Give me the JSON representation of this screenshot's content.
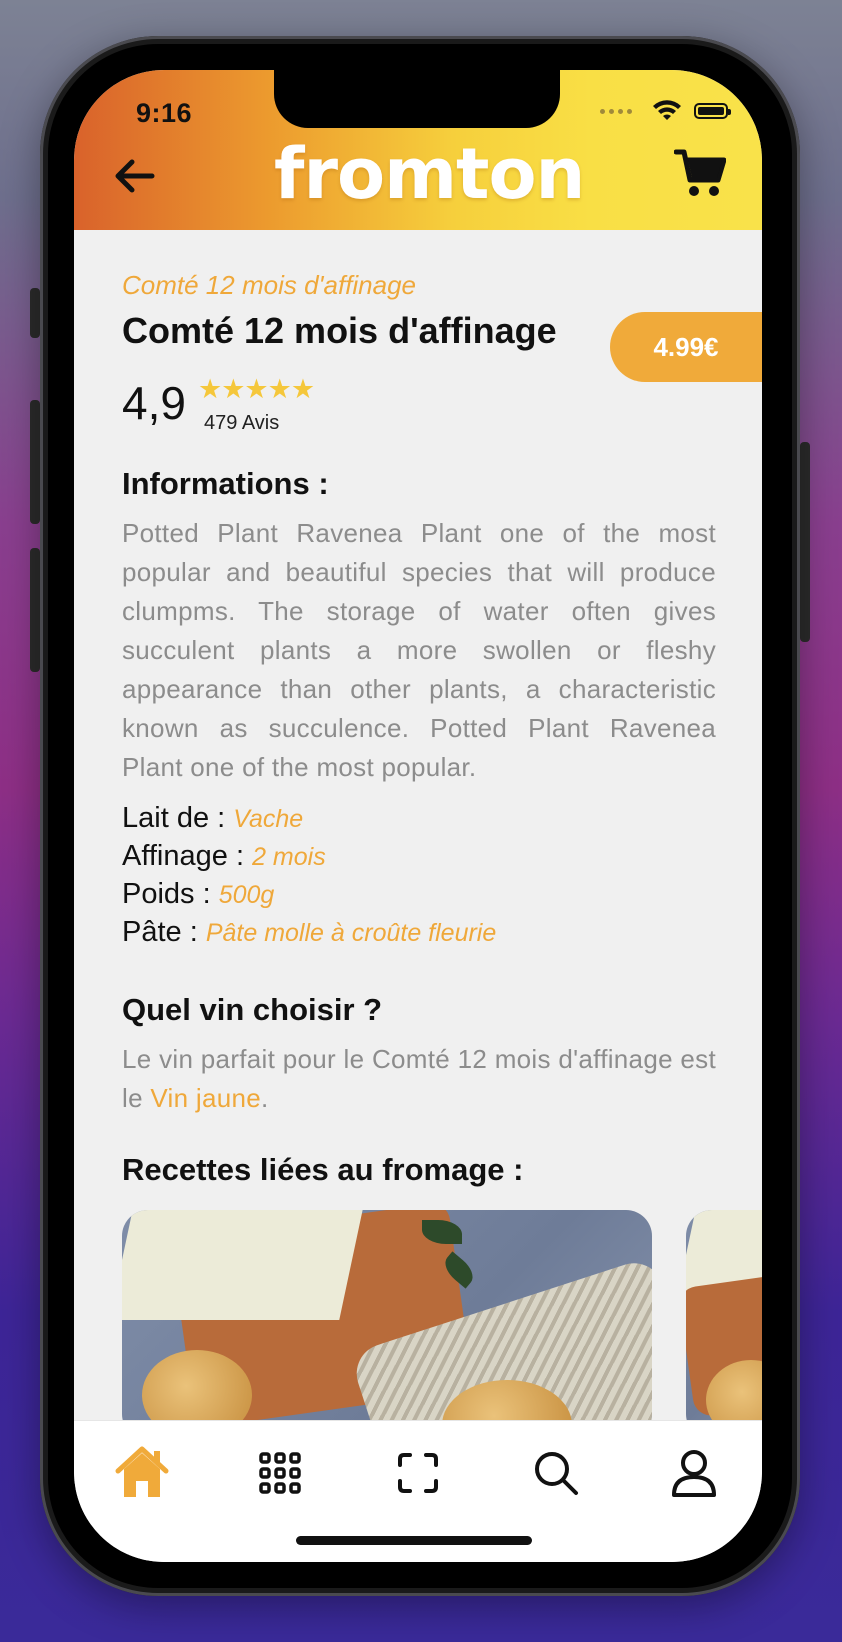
{
  "status_bar": {
    "time": "9:16"
  },
  "header": {
    "logo_text": "fromton",
    "back_icon": "arrow-left-icon",
    "cart_icon": "cart-icon"
  },
  "product": {
    "subtitle": "Comté 12 mois d'affinage",
    "title": "Comté 12 mois d'affinage",
    "price": "4.99€",
    "rating": "4,9",
    "stars": "★★★★★",
    "reviews": "479 Avis"
  },
  "informations": {
    "heading": "Informations :",
    "text": "Potted Plant Ravenea Plant one of the most popular and beautiful species that will produce clumpms. The storage of water often gives succulent plants a more swollen or fleshy appearance than other plants, a characteristic known as succulence. Potted Plant Ravenea Plant one of the most popular."
  },
  "specs": [
    {
      "label": "Lait de : ",
      "value": "Vache"
    },
    {
      "label": "Affinage : ",
      "value": "2 mois"
    },
    {
      "label": "Poids : ",
      "value": "500g"
    },
    {
      "label": "Pâte : ",
      "value": "Pâte molle à croûte fleurie"
    }
  ],
  "wine": {
    "heading": "Quel vin choisir ?",
    "text_before": "Le vin parfait pour le Comté 12 mois d'affinage est le ",
    "wine_name": "Vin jaune",
    "text_after": "."
  },
  "recipes": {
    "heading": "Recettes liées au fromage :"
  },
  "tabbar": {
    "items": [
      {
        "icon": "home-icon",
        "active": true
      },
      {
        "icon": "grid-icon",
        "active": false
      },
      {
        "icon": "scan-icon",
        "active": false
      },
      {
        "icon": "search-icon",
        "active": false
      },
      {
        "icon": "user-icon",
        "active": false
      }
    ]
  },
  "colors": {
    "accent": "#efa83a",
    "star": "#f5c73b",
    "header_start": "#d9622b",
    "header_end": "#f9e24a"
  }
}
